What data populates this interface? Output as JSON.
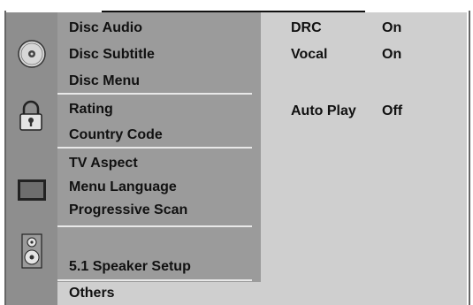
{
  "menu": {
    "groups": [
      {
        "icon": "disc-icon",
        "items": [
          "Disc Audio",
          "Disc Subtitle",
          "Disc Menu"
        ]
      },
      {
        "icon": "lock-icon",
        "items": [
          "Rating",
          "Country Code"
        ]
      },
      {
        "icon": "tv-icon",
        "items": [
          "TV Aspect",
          "Menu Language",
          "Progressive Scan"
        ]
      },
      {
        "icon": "speaker-icon",
        "items": [
          "5.1 Speaker Setup"
        ]
      },
      {
        "icon": "",
        "items": [
          "Others"
        ]
      }
    ],
    "selected": "Others"
  },
  "settings": [
    {
      "label": "DRC",
      "value": "On"
    },
    {
      "label": "Vocal",
      "value": "On"
    },
    {
      "label": "Auto Play",
      "value": "Off"
    }
  ],
  "colors": {
    "sidebar": "#9b9b9b",
    "icon_column": "#8e8e8e",
    "content": "#cfcfcf",
    "selected": "#cfcfcf",
    "divider": "#e8e8e8"
  }
}
